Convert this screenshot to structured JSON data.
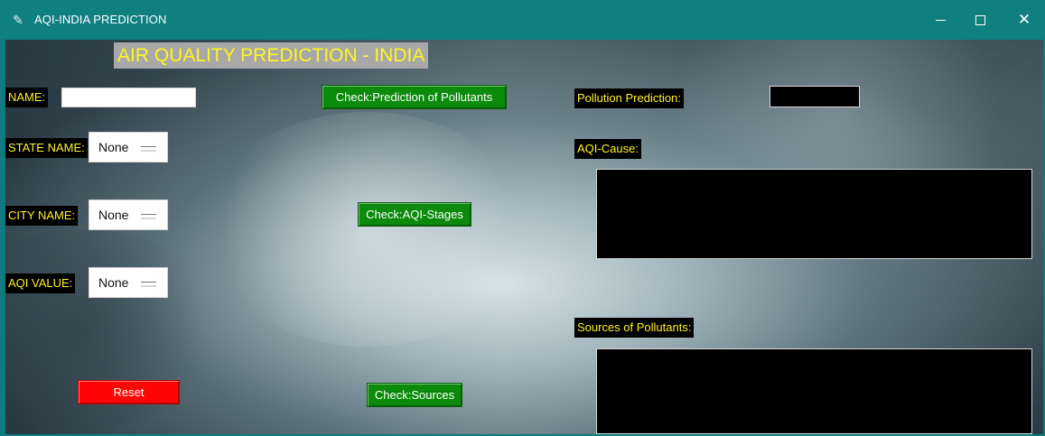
{
  "window": {
    "title": "AQI-INDIA PREDICTION",
    "controls": {
      "minimize": "minimize-icon",
      "maximize": "maximize-icon",
      "close": "close-icon"
    }
  },
  "header": {
    "title": "AIR QUALITY PREDICTION - INDIA"
  },
  "form": {
    "name_label": "NAME:",
    "name_value": "",
    "state_label": "STATE NAME:",
    "state_value": "None",
    "city_label": "CITY NAME:",
    "city_value": "None",
    "aqi_label": "AQI VALUE:",
    "aqi_value": "None"
  },
  "buttons": {
    "prediction": "Check:Prediction of Pollutants",
    "stages": "Check:AQI-Stages",
    "sources": "Check:Sources",
    "reset": "Reset"
  },
  "results": {
    "pollution_prediction_label": "Pollution Prediction:",
    "pollution_prediction_value": "",
    "aqi_cause_label": "AQI-Cause:",
    "aqi_cause_value": "",
    "sources_label": "Sources of Pollutants:",
    "sources_value": ""
  },
  "colors": {
    "titlebar": "#0f7f80",
    "label_bg": "#000000",
    "label_text": "#fff12a",
    "green_button": "#0b8a0b",
    "reset_button": "#ff0505",
    "heading_bg": "#a8a8a8",
    "heading_text": "#fff61f"
  }
}
